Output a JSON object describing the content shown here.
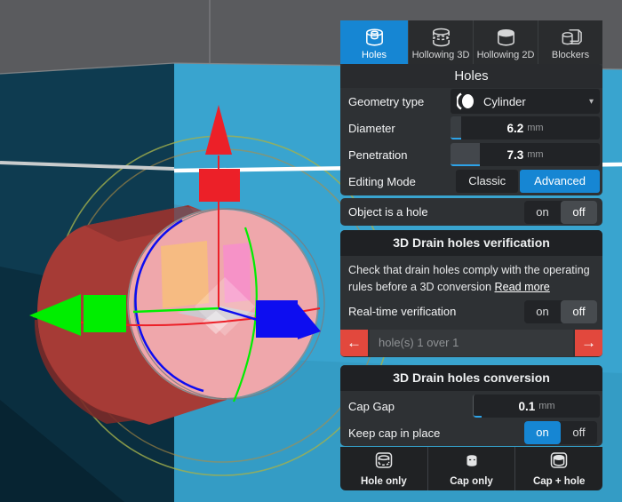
{
  "panel": {
    "tabs": [
      {
        "label": "Holes",
        "icon": "holes-cylinder",
        "active": true
      },
      {
        "label": "Hollowing 3D",
        "icon": "hollowing-3d-cylinder",
        "active": false
      },
      {
        "label": "Hollowing 2D",
        "icon": "hollowing-2d-cylinder",
        "active": false
      },
      {
        "label": "Blockers",
        "icon": "blocker-cube-cylinder",
        "active": false
      }
    ],
    "title": "Holes",
    "geometry_type": {
      "label": "Geometry type",
      "value": "Cylinder",
      "caret": "▾"
    },
    "diameter": {
      "label": "Diameter",
      "value": "6.2",
      "unit": "mm"
    },
    "penetration": {
      "label": "Penetration",
      "value": "7.3",
      "unit": "mm"
    },
    "editing_mode": {
      "label": "Editing Mode",
      "options": [
        "Classic",
        "Advanced"
      ],
      "selected": "Advanced"
    },
    "toggle_labels": {
      "on": "on",
      "off": "off"
    },
    "object_is_a_hole": {
      "label": "Object is a hole",
      "value": "off"
    },
    "verification": {
      "title": "3D Drain holes verification",
      "description": "Check that drain holes comply with the operating rules before a 3D conversion",
      "link": "Read more",
      "realtime": {
        "label": "Real-time verification",
        "value": "off"
      },
      "nav": {
        "prev_icon": "←",
        "next_icon": "→",
        "status": "hole(s) 1 over 1"
      }
    },
    "conversion": {
      "title": "3D Drain holes conversion",
      "cap_gap": {
        "label": "Cap Gap",
        "value": "0.1",
        "unit": "mm"
      },
      "keep_cap": {
        "label": "Keep cap in place",
        "value": "on"
      }
    },
    "actions": [
      {
        "label": "Hole only",
        "icon": "box-with-hole"
      },
      {
        "label": "Cap only",
        "icon": "cap-cylinder"
      },
      {
        "label": "Cap + hole",
        "icon": "box-with-cap-and-hole"
      }
    ],
    "colors": {
      "accent_blue": "#1686d3",
      "accent_red": "#e2483d"
    }
  },
  "scene": {
    "colors": {
      "background": "#5a5b5e",
      "cube_left": "#0e3b50",
      "cube_right": "#39a4cf",
      "slice_left": "#c9cccd",
      "slice_right": "#ffffff",
      "cylinder": "#a63b36",
      "cylinder_dark": "#8c3330",
      "cylinder_shadow": "#7a2a28",
      "sphere": "#efa7ab",
      "decal_orange": "#f6bc7f",
      "decal_pink": "#f590c8",
      "axis_x": "#ec2028",
      "axis_y": "#00ee00",
      "axis_z": "#0d0df0",
      "ring_inner": "#b08e42",
      "ring_outer": "#a2b04c",
      "grid_gray": "#8b8e90"
    }
  }
}
